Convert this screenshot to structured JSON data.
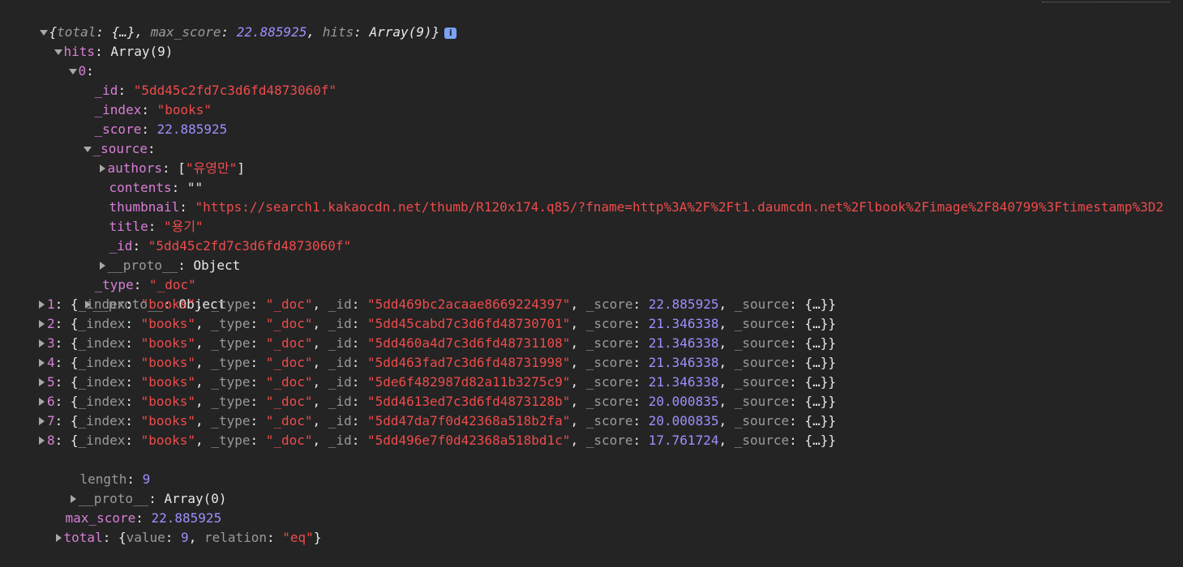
{
  "root": {
    "preview": {
      "open": "{",
      "total_key": "total",
      "total_val": "{…}",
      "max_score_key": "max_score",
      "max_score_val": "22.885925",
      "hits_key": "hits",
      "hits_val": "Array(9)",
      "close": "}"
    },
    "info_icon": "i"
  },
  "hits": {
    "key": "hits",
    "summary": "Array(9)",
    "item0": {
      "key": "0",
      "id_key": "_id",
      "id_val": "\"5dd45c2fd7c3d6fd4873060f\"",
      "index_key": "_index",
      "index_val": "\"books\"",
      "score_key": "_score",
      "score_val": "22.885925",
      "source": {
        "key": "_source",
        "authors_key": "authors",
        "authors_val": "\"유영만\"",
        "contents_key": "contents",
        "contents_val": "\"\"",
        "thumbnail_key": "thumbnail",
        "thumbnail_val": "\"https://search1.kakaocdn.net/thumb/R120x174.q85/?fname=http%3A%2F%2Ft1.daumcdn.net%2Flbook%2Fimage%2F840799%3Ftimestamp%3D2",
        "thumbnail_ellipsis": "…",
        "title_key": "title",
        "title_val": "\"용기\"",
        "id_key": "_id",
        "id_val": "\"5dd45c2fd7c3d6fd4873060f\"",
        "proto_key": "__proto__",
        "proto_val": "Object"
      },
      "type_key": "_type",
      "type_val": "\"_doc\"",
      "proto_key": "__proto__",
      "proto_val": "Object"
    },
    "collapsed_items": [
      {
        "key": "1",
        "id": "\"5dd469bc2acaae8669224397\"",
        "score": "22.885925"
      },
      {
        "key": "2",
        "id": "\"5dd45cabd7c3d6fd48730701\"",
        "score": "21.346338"
      },
      {
        "key": "3",
        "id": "\"5dd460a4d7c3d6fd48731108\"",
        "score": "21.346338"
      },
      {
        "key": "4",
        "id": "\"5dd463fad7c3d6fd48731998\"",
        "score": "21.346338"
      },
      {
        "key": "5",
        "id": "\"5de6f482987d82a11b3275c9\"",
        "score": "21.346338"
      },
      {
        "key": "6",
        "id": "\"5dd4613ed7c3d6fd4873128b\"",
        "score": "20.000835"
      },
      {
        "key": "7",
        "id": "\"5dd47da7f0d42368a518b2fa\"",
        "score": "20.000835"
      },
      {
        "key": "8",
        "id": "\"5dd496e7f0d42368a518bd1c\"",
        "score": "17.761724"
      }
    ],
    "collapsed_labels": {
      "index_key": "_index",
      "index_val": "\"books\"",
      "type_key": "_type",
      "type_val": "\"_doc\"",
      "id_key": "_id",
      "score_key": "_score",
      "source_key": "_source",
      "source_val": "{…}"
    },
    "length_key": "length",
    "length_val": "9",
    "proto_key": "__proto__",
    "proto_val": "Array(0)"
  },
  "max_score": {
    "key": "max_score",
    "val": "22.885925"
  },
  "total": {
    "key": "total",
    "value_key": "value",
    "value_val": "9",
    "relation_key": "relation",
    "relation_val": "\"eq\""
  }
}
